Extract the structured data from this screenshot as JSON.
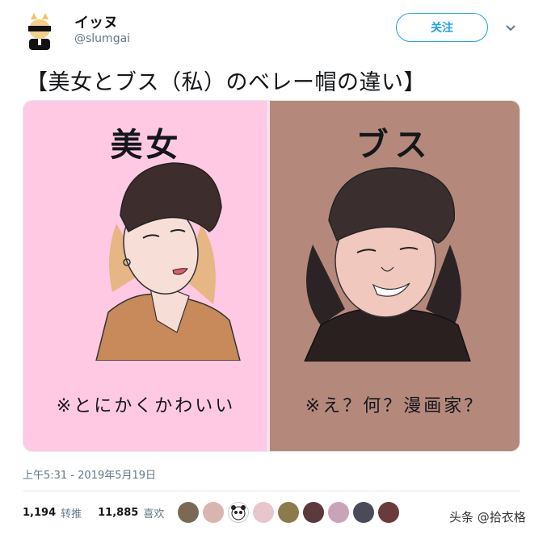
{
  "tweet": {
    "display_name": "イッヌ",
    "handle": "@slumgai",
    "follow_label": "关注",
    "text": "【美女とブス（私）のベレー帽の違い】",
    "timestamp": "上午5:31 - 2019年5月19日",
    "retweets_count": "1,194",
    "retweets_label": "转推",
    "likes_count": "11,885",
    "likes_label": "喜欢"
  },
  "media": {
    "left_title": "美女",
    "right_title": "ブス",
    "left_caption": "※とにかくかわいい",
    "right_caption": "※え？何？漫画家？",
    "colors": {
      "left_bg": "#ffc9e3",
      "right_bg": "#b4897b",
      "beret": "#3a2a2a"
    }
  },
  "liker_avatars": [
    "avatar-1",
    "avatar-2",
    "avatar-panda",
    "avatar-4",
    "avatar-5",
    "avatar-6",
    "avatar-7",
    "avatar-8",
    "avatar-9"
  ],
  "watermark": "头条 @拾衣格"
}
